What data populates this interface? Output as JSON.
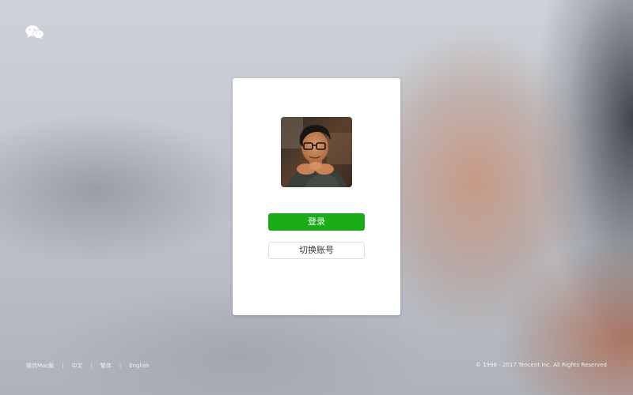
{
  "app": {
    "logo_icon": "wechat-logo-icon"
  },
  "login_card": {
    "avatar_alt": "user-avatar",
    "login_label": "登录",
    "switch_account_label": "切换账号"
  },
  "footer": {
    "links": [
      {
        "label": "微信Mac版"
      },
      {
        "label": "中文"
      },
      {
        "label": "繁体"
      },
      {
        "label": "English"
      }
    ],
    "separator": "|",
    "copyright": "© 1998 - 2017 Tencent Inc. All Rights Reserved"
  },
  "colors": {
    "primary_green": "#1aad19",
    "card_bg": "#ffffff"
  }
}
